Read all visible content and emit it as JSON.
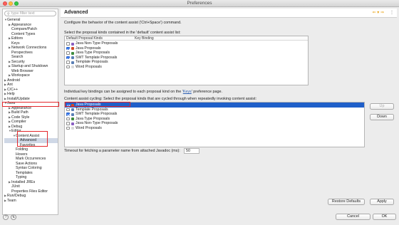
{
  "window": {
    "title": "Preferences"
  },
  "sidebar": {
    "filter_placeholder": "type filter text",
    "tree": [
      {
        "label": "General",
        "level": 0,
        "expander": "open"
      },
      {
        "label": "Appearance",
        "level": 1,
        "expander": "closed"
      },
      {
        "label": "Compare/Patch",
        "level": 1,
        "expander": ""
      },
      {
        "label": "Content Types",
        "level": 1,
        "expander": ""
      },
      {
        "label": "Editors",
        "level": 1,
        "expander": "closed"
      },
      {
        "label": "Keys",
        "level": 1,
        "expander": ""
      },
      {
        "label": "Network Connections",
        "level": 1,
        "expander": "closed"
      },
      {
        "label": "Perspectives",
        "level": 1,
        "expander": ""
      },
      {
        "label": "Search",
        "level": 1,
        "expander": ""
      },
      {
        "label": "Security",
        "level": 1,
        "expander": "closed"
      },
      {
        "label": "Startup and Shutdown",
        "level": 1,
        "expander": "closed"
      },
      {
        "label": "Web Browser",
        "level": 1,
        "expander": ""
      },
      {
        "label": "Workspace",
        "level": 1,
        "expander": "closed"
      },
      {
        "label": "Android",
        "level": 0,
        "expander": "closed"
      },
      {
        "label": "Ant",
        "level": 0,
        "expander": "closed"
      },
      {
        "label": "C/C++",
        "level": 0,
        "expander": "closed"
      },
      {
        "label": "Help",
        "level": 0,
        "expander": "closed"
      },
      {
        "label": "Install/Update",
        "level": 0,
        "expander": "closed"
      },
      {
        "label": "Java",
        "level": 0,
        "expander": "open"
      },
      {
        "label": "Appearance",
        "level": 1,
        "expander": "closed"
      },
      {
        "label": "Build Path",
        "level": 1,
        "expander": "closed"
      },
      {
        "label": "Code Style",
        "level": 1,
        "expander": "closed"
      },
      {
        "label": "Compiler",
        "level": 1,
        "expander": "closed"
      },
      {
        "label": "Debug",
        "level": 1,
        "expander": "closed"
      },
      {
        "label": "Editor",
        "level": 1,
        "expander": "open"
      },
      {
        "label": "Content Assist",
        "level": 2,
        "expander": "open"
      },
      {
        "label": "Advanced",
        "level": 3,
        "expander": "",
        "selected": true
      },
      {
        "label": "Favorites",
        "level": 3,
        "expander": ""
      },
      {
        "label": "Folding",
        "level": 2,
        "expander": ""
      },
      {
        "label": "Hovers",
        "level": 2,
        "expander": ""
      },
      {
        "label": "Mark Occurrences",
        "level": 2,
        "expander": ""
      },
      {
        "label": "Save Actions",
        "level": 2,
        "expander": ""
      },
      {
        "label": "Syntax Coloring",
        "level": 2,
        "expander": ""
      },
      {
        "label": "Templates",
        "level": 2,
        "expander": ""
      },
      {
        "label": "Typing",
        "level": 2,
        "expander": ""
      },
      {
        "label": "Installed JREs",
        "level": 1,
        "expander": "closed"
      },
      {
        "label": "JUnit",
        "level": 1,
        "expander": ""
      },
      {
        "label": "Properties Files Editor",
        "level": 1,
        "expander": ""
      },
      {
        "label": "Run/Debug",
        "level": 0,
        "expander": "closed"
      },
      {
        "label": "Team",
        "level": 0,
        "expander": "closed"
      }
    ]
  },
  "main": {
    "title": "Advanced",
    "description": "Configure the behavior of the content assist ('Ctrl+Space') command.",
    "default_list_label": "Select the proposal kinds contained in the 'default' content assist list:",
    "default_list_headers": [
      "Default Proposal Kinds",
      "Key Binding"
    ],
    "default_list": [
      {
        "label": "Java Non-Type Proposals",
        "checked": false,
        "icon_color": "#8a5fc2"
      },
      {
        "label": "Java Proposals",
        "checked": true,
        "icon_color": "#d24a2a"
      },
      {
        "label": "Java Type Proposals",
        "checked": false,
        "icon_color": "#3f8d3f"
      },
      {
        "label": "SWT Template Proposals",
        "checked": true,
        "icon_color": "#5a7fb5"
      },
      {
        "label": "Template Proposals",
        "checked": false,
        "icon_color": "#5a7fb5"
      },
      {
        "label": "Word Proposals",
        "checked": false,
        "icon_color": "#d9d9d9"
      }
    ],
    "key_binding_text_prefix": "Individual key bindings can be assigned to each proposal kind on the '",
    "key_binding_link": "Keys",
    "key_binding_text_suffix": "' preference page.",
    "cycling_label": "Content assist cycling: Select the proposal kinds that are cycled through when repeatedly invoking content assist:",
    "cycling_list": [
      {
        "label": "Java Proposals",
        "checked": true,
        "selected": true,
        "icon_color": "#d24a2a"
      },
      {
        "label": "Template Proposals",
        "checked": false,
        "icon_color": "#5a7fb5"
      },
      {
        "label": "SWT Template Proposals",
        "checked": true,
        "icon_color": "#5a7fb5"
      },
      {
        "label": "Java Type Proposals",
        "checked": false,
        "icon_color": "#3f8d3f"
      },
      {
        "label": "Java Non-Type Proposals",
        "checked": false,
        "icon_color": "#8a5fc2"
      },
      {
        "label": "Word Proposals",
        "checked": false,
        "icon_color": "#d9d9d9"
      }
    ],
    "up_label": "Up",
    "down_label": "Down",
    "timeout_label": "Timeout for fetching a parameter name from attached Javadoc (ms):",
    "timeout_value": "50",
    "restore_defaults_label": "Restore Defaults",
    "apply_label": "Apply"
  },
  "footer": {
    "cancel_label": "Cancel",
    "ok_label": "OK"
  },
  "colors": {
    "selection": "#1f5fc9",
    "highlight_box": "#e3272b",
    "nav_arrows": "#e8a317"
  }
}
